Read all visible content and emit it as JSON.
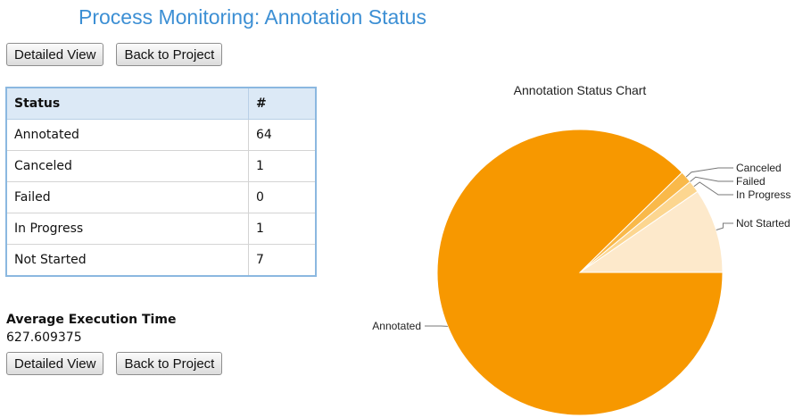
{
  "header": {
    "title": "Process Monitoring: Annotation Status"
  },
  "buttons": {
    "detailed_view": "Detailed View",
    "back_to_project": "Back to Project"
  },
  "status_table": {
    "headers": {
      "status": "Status",
      "count": "#"
    },
    "rows": [
      {
        "status": "Annotated",
        "count": "64"
      },
      {
        "status": "Canceled",
        "count": "1"
      },
      {
        "status": "Failed",
        "count": "0"
      },
      {
        "status": "In Progress",
        "count": "1"
      },
      {
        "status": "Not Started",
        "count": "7"
      }
    ]
  },
  "average_execution": {
    "label": "Average Execution Time",
    "value": "627.609375"
  },
  "colors": {
    "title_blue": "#3c8fd4",
    "annotated": "#f79800",
    "canceled": "#f9b94a",
    "failed": "#fbcf80",
    "in_progress": "#fcd690",
    "not_started": "#fde9cb"
  },
  "chart_data": {
    "type": "pie",
    "title": "Annotation Status Chart",
    "slices": [
      {
        "label": "Annotated",
        "value": 64,
        "color": "#f79800"
      },
      {
        "label": "Canceled",
        "value": 1,
        "color": "#f9b94a"
      },
      {
        "label": "Failed",
        "value": 0,
        "color": "#fbcf80"
      },
      {
        "label": "In Progress",
        "value": 1,
        "color": "#fcd690"
      },
      {
        "label": "Not Started",
        "value": 7,
        "color": "#fde9cb"
      }
    ]
  }
}
